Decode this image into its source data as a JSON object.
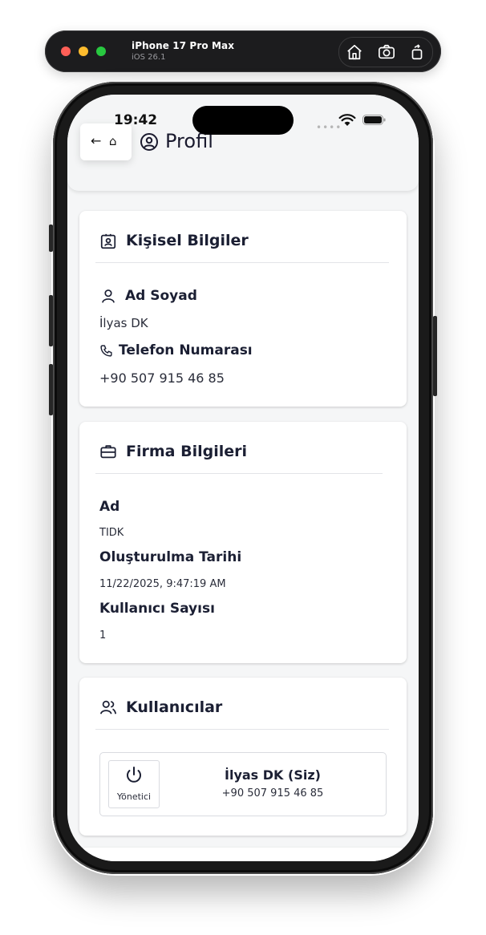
{
  "simulator": {
    "device": "iPhone 17 Pro Max",
    "os": "iOS 26.1"
  },
  "status_bar": {
    "time": "19:42"
  },
  "header": {
    "back_icon_glyph": "←",
    "home_icon_glyph": "⌂",
    "title": "Profil"
  },
  "personal": {
    "title": "Kişisel Bilgiler",
    "name_label": "Ad Soyad",
    "name_value": "İlyas DK",
    "phone_label": "Telefon Numarası",
    "phone_value": "+90 507 915 46 85"
  },
  "company": {
    "title": "Firma Bilgileri",
    "name_label": "Ad",
    "name_value": "TIDK",
    "created_label": "Oluşturulma Tarihi",
    "created_value": "11/22/2025, 9:47:19 AM",
    "user_count_label": "Kullanıcı Sayısı",
    "user_count_value": "1"
  },
  "users": {
    "title": "Kullanıcılar",
    "items": [
      {
        "role": "Yönetici",
        "name": "İlyas DK (Siz)",
        "phone": "+90 507 915 46 85"
      }
    ]
  },
  "icons": {
    "sim_home": "home-icon",
    "sim_screenshot": "camera-icon",
    "sim_rotate": "rotate-icon",
    "profile": "user-circle-icon",
    "personal": "id-badge-icon",
    "person": "user-icon",
    "phone": "phone-icon",
    "company": "briefcase-icon",
    "users": "users-icon",
    "role": "power-icon"
  },
  "colors": {
    "text_dark": "#1b1f33",
    "traffic_red": "#ff5f57",
    "traffic_yellow": "#febc2e",
    "traffic_green": "#28c840"
  }
}
